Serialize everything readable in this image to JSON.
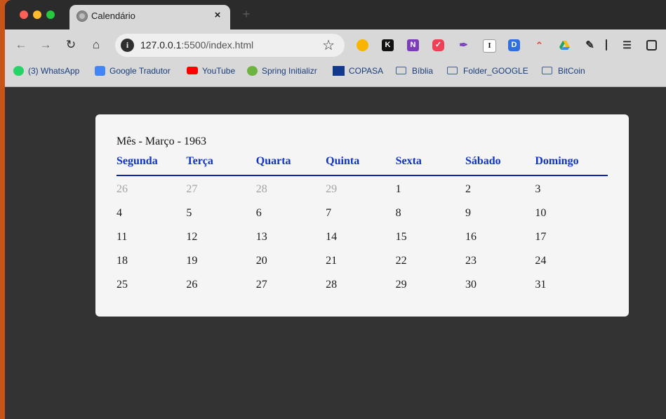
{
  "browser": {
    "tab_title": "Calendário",
    "tab_close": "×",
    "new_tab": "+",
    "url_host": "127.0.0.1",
    "url_rest": ":5500/index.html",
    "bookmarks": [
      {
        "label": "(3) WhatsApp",
        "icon": "whatsapp-icon",
        "color": "#25d366"
      },
      {
        "label": "Google Tradutor",
        "icon": "translate-icon",
        "color": "#4285f4"
      },
      {
        "label": "YouTube",
        "icon": "youtube-icon",
        "color": "#ff0000"
      },
      {
        "label": "Spring Initializr",
        "icon": "spring-icon",
        "color": "#6db33f"
      },
      {
        "label": "COPASA",
        "icon": "copasa-icon",
        "color": "#123a8c"
      },
      {
        "label": "Bíblia",
        "icon": "folder-icon"
      },
      {
        "label": "Folder_GOOGLE",
        "icon": "folder-icon"
      },
      {
        "label": "BitCoin",
        "icon": "folder-icon"
      }
    ],
    "extensions": [
      "keep-icon",
      "kindle-icon",
      "onenote-icon",
      "pocket-icon",
      "quill-icon",
      "instapaper-icon",
      "d-icon",
      "rainbow-icon",
      "drive-icon",
      "puzzle-icon"
    ]
  },
  "calendar": {
    "title": "Mês - Março - 1963",
    "weekdays": [
      "Segunda",
      "Terça",
      "Quarta",
      "Quinta",
      "Sexta",
      "Sábado",
      "Domingo"
    ],
    "weeks": [
      [
        {
          "d": "26",
          "m": true
        },
        {
          "d": "27",
          "m": true
        },
        {
          "d": "28",
          "m": true
        },
        {
          "d": "29",
          "m": true
        },
        {
          "d": "1"
        },
        {
          "d": "2"
        },
        {
          "d": "3"
        }
      ],
      [
        {
          "d": "4"
        },
        {
          "d": "5"
        },
        {
          "d": "6"
        },
        {
          "d": "7"
        },
        {
          "d": "8"
        },
        {
          "d": "9"
        },
        {
          "d": "10"
        }
      ],
      [
        {
          "d": "11"
        },
        {
          "d": "12"
        },
        {
          "d": "13"
        },
        {
          "d": "14"
        },
        {
          "d": "15"
        },
        {
          "d": "16"
        },
        {
          "d": "17"
        }
      ],
      [
        {
          "d": "18"
        },
        {
          "d": "19"
        },
        {
          "d": "20"
        },
        {
          "d": "21"
        },
        {
          "d": "22"
        },
        {
          "d": "23"
        },
        {
          "d": "24"
        }
      ],
      [
        {
          "d": "25"
        },
        {
          "d": "26"
        },
        {
          "d": "27"
        },
        {
          "d": "28"
        },
        {
          "d": "29"
        },
        {
          "d": "30"
        },
        {
          "d": "31"
        }
      ]
    ]
  }
}
